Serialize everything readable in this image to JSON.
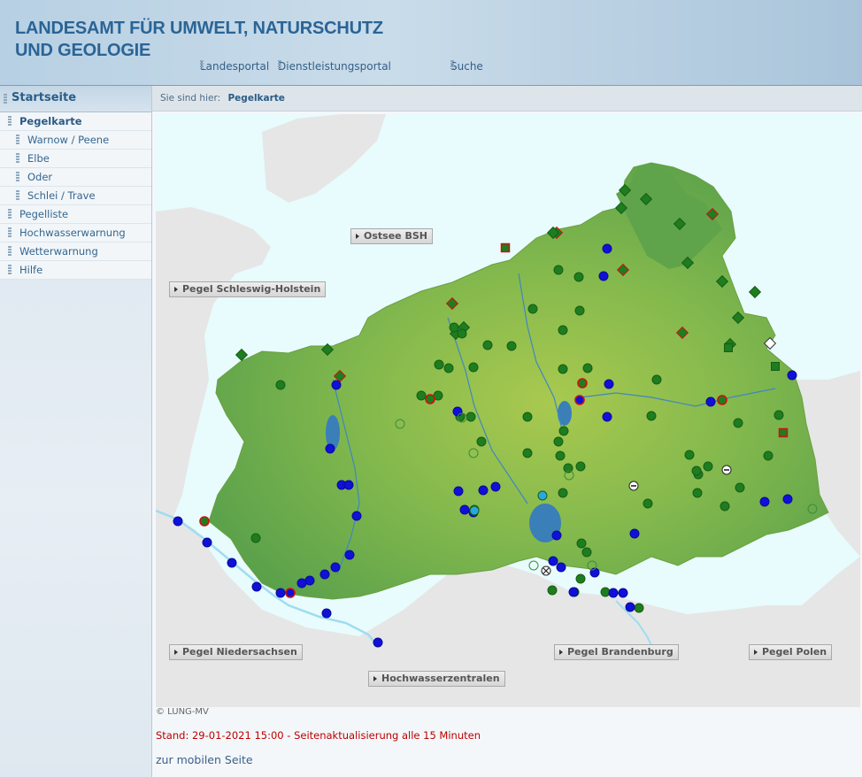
{
  "header": {
    "org_line1": "LANDESAMT FÜR UMWELT, NATURSCHUTZ",
    "org_line2": "UND GEOLOGIE",
    "links": [
      "Landesportal",
      "Dienstleistungsportal",
      "Suche"
    ]
  },
  "sidebar": {
    "home": "Startseite",
    "items": [
      {
        "label": "Pegelkarte",
        "level": 1,
        "active": true
      },
      {
        "label": "Warnow / Peene",
        "level": 2
      },
      {
        "label": "Elbe",
        "level": 2
      },
      {
        "label": "Oder",
        "level": 2
      },
      {
        "label": "Schlei / Trave",
        "level": 2
      },
      {
        "label": "Pegelliste",
        "level": 1
      },
      {
        "label": "Hochwasserwarnung",
        "level": 1
      },
      {
        "label": "Wetterwarnung",
        "level": 1
      },
      {
        "label": "Hilfe",
        "level": 1
      }
    ]
  },
  "breadcrumb": {
    "prefix": "Sie sind hier:",
    "current": "Pegelkarte"
  },
  "map": {
    "buttons": {
      "ostsee": "Ostsee BSH",
      "sh": "Pegel Schleswig-Holstein",
      "nds": "Pegel Niedersachsen",
      "bb": "Pegel Brandenburg",
      "pl": "Pegel Polen",
      "hwz": "Hochwasserzentralen"
    },
    "colors": {
      "sea": "#e8fbfd",
      "land": "#7fb954",
      "green_marker": "#1e7d1e",
      "blue_marker": "#1010d8",
      "cyan_marker": "#27a8e0",
      "red_outline": "#d01010"
    }
  },
  "footer": {
    "copyright": "© LUNG-MV",
    "stand": "Stand: 29-01-2021 15:00 - Seitenaktualisierung alle 15 Minuten",
    "mobile": "zur mobilen Seite"
  }
}
